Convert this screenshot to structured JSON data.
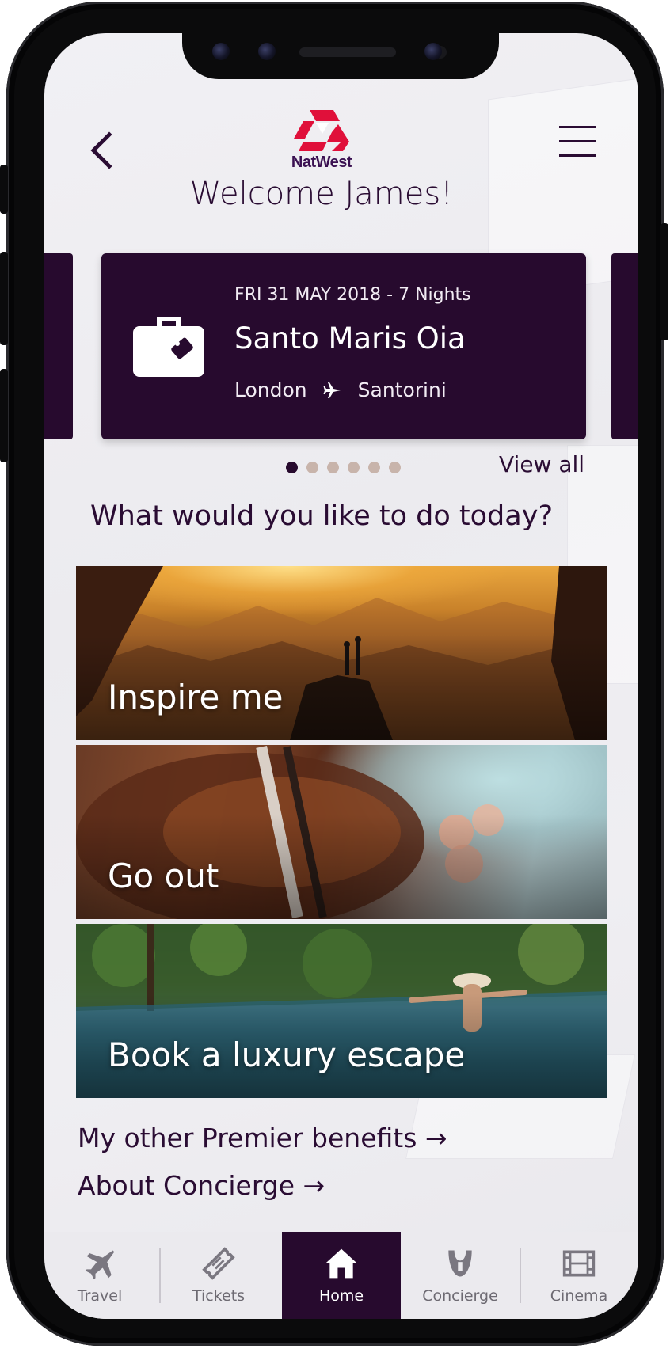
{
  "header": {
    "brand": "NatWest",
    "welcome": "Welcome James!"
  },
  "trip_card": {
    "date": "FRI 31 MAY 2018 - 7 Nights",
    "hotel": "Santo Maris Oia",
    "from": "London",
    "to": "Santorini"
  },
  "carousel": {
    "page_count": 6,
    "active_index": 0,
    "view_all": "View all"
  },
  "question": "What would you like to do today?",
  "tiles": [
    {
      "label": "Inspire me"
    },
    {
      "label": "Go out"
    },
    {
      "label": "Book a luxury escape"
    }
  ],
  "links": [
    {
      "label": "My other Premier benefits →"
    },
    {
      "label": "About Concierge →"
    }
  ],
  "tabbar": [
    {
      "label": "Travel",
      "icon": "airplane-icon"
    },
    {
      "label": "Tickets",
      "icon": "ticket-icon"
    },
    {
      "label": "Home",
      "icon": "home-icon",
      "active": true
    },
    {
      "label": "Concierge",
      "icon": "concierge-icon"
    },
    {
      "label": "Cinema",
      "icon": "film-icon"
    }
  ],
  "colors": {
    "brand_dark": "#270a2e",
    "text": "#2a0c33",
    "logo_red": "#e0103a",
    "dot_inactive": "#c8b4ab"
  }
}
